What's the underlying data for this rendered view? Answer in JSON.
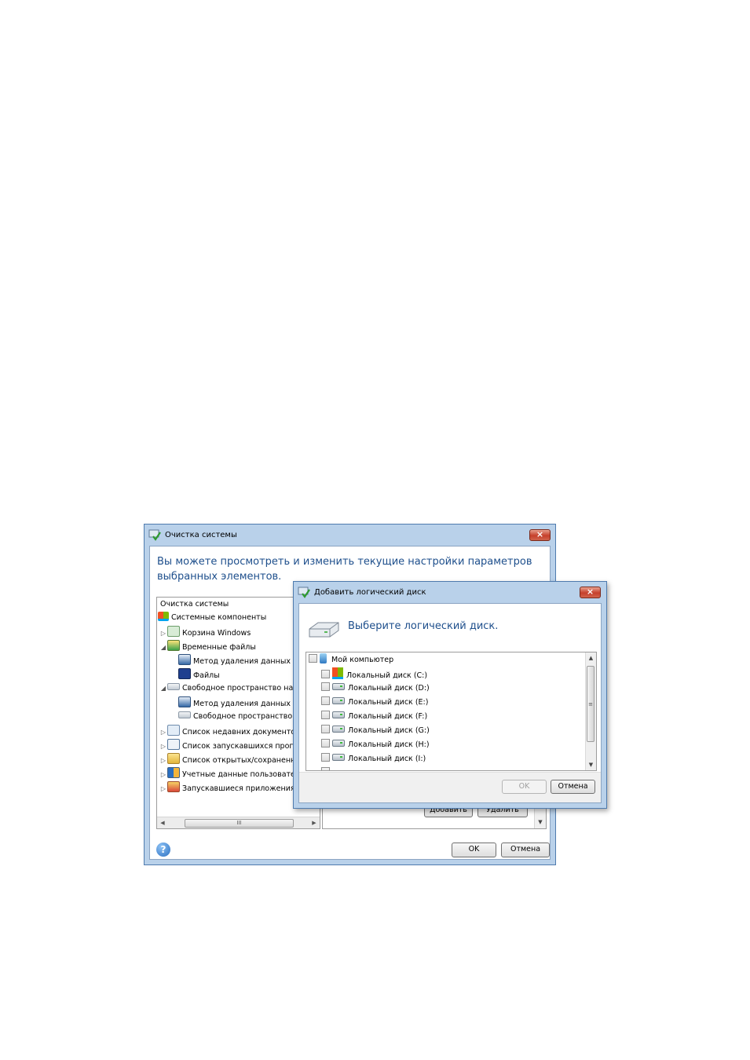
{
  "main_window": {
    "title": "Очистка системы",
    "heading": "Вы можете просмотреть и изменить текущие настройки параметров выбранных элементов.",
    "tree": [
      {
        "label": "Очистка системы"
      },
      {
        "label": "Системные компоненты"
      },
      {
        "label": "Корзина Windows"
      },
      {
        "label": "Временные файлы"
      },
      {
        "label": "Метод удаления данных"
      },
      {
        "label": "Файлы"
      },
      {
        "label": "Свободное пространство на д"
      },
      {
        "label": "Метод удаления данных"
      },
      {
        "label": "Свободное пространство д"
      },
      {
        "label": "Список недавних документов"
      },
      {
        "label": "Список запускавшихся прогр"
      },
      {
        "label": "Список открытых/сохраненн"
      },
      {
        "label": "Учетные данные пользовател"
      },
      {
        "label": "Запускавшиеся приложения"
      }
    ],
    "hscroll_grip": "III",
    "add_label": "Добавить",
    "remove_label": "Удалить",
    "ok_label": "OK",
    "cancel_label": "Отмена",
    "help_label": "?"
  },
  "dialog": {
    "title": "Добавить логический диск",
    "heading": "Выберите логический диск.",
    "root_label": "Мой компьютер",
    "drives": [
      {
        "label": "Локальный диск (C:)",
        "icon": "windows-drive-icon"
      },
      {
        "label": "Локальный диск (D:)",
        "icon": "hard-drive-icon"
      },
      {
        "label": "Локальный диск (E:)",
        "icon": "hard-drive-icon"
      },
      {
        "label": "Локальный диск (F:)",
        "icon": "hard-drive-icon"
      },
      {
        "label": "Локальный диск (G:)",
        "icon": "hard-drive-icon"
      },
      {
        "label": "Локальный диск (H:)",
        "icon": "hard-drive-icon"
      },
      {
        "label": "Локальный диск (I:)",
        "icon": "hard-drive-icon"
      }
    ],
    "scroll_grip": "≡",
    "ok_label": "OK",
    "cancel_label": "Отмена",
    "ok_enabled": false
  },
  "icons": {
    "close": "×",
    "expand": "▷",
    "collapse": "◢",
    "scroll_up": "▲",
    "scroll_down": "▼",
    "scroll_left": "◀",
    "scroll_right": "▶"
  },
  "colors": {
    "heading_blue": "#1e4f8c",
    "title_frame": "#b9d1ea",
    "close_red": "#c6402b"
  }
}
